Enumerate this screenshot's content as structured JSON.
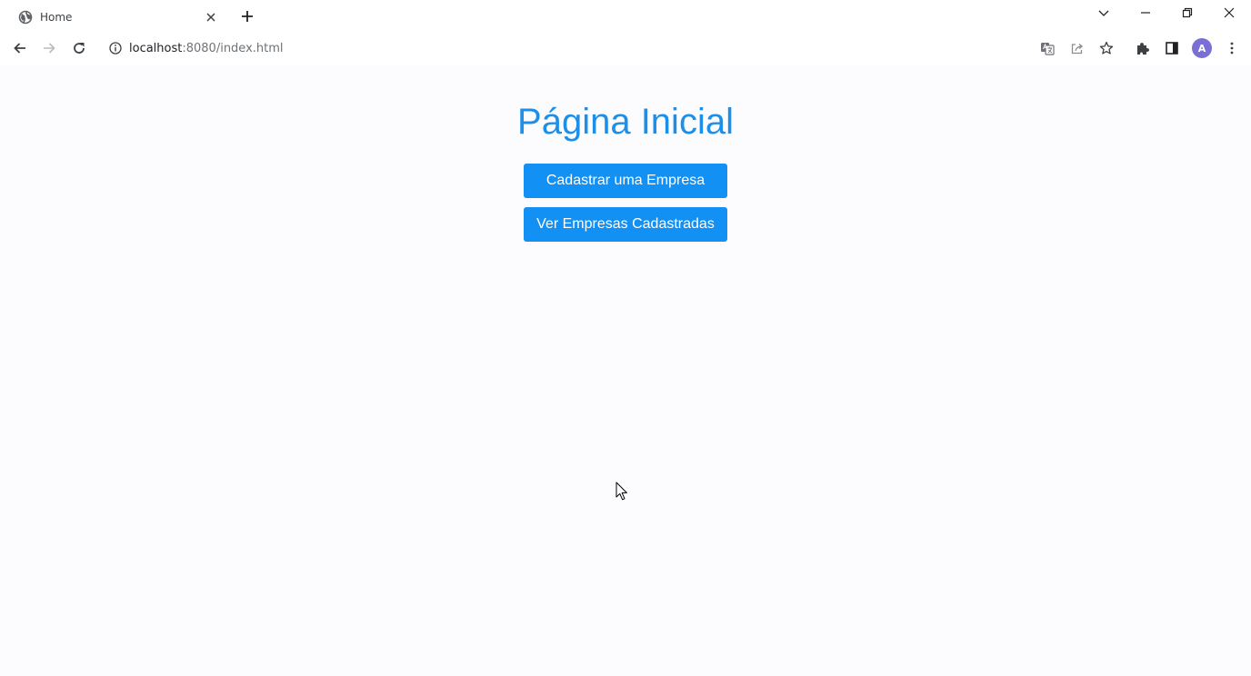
{
  "browser": {
    "tab": {
      "title": "Home"
    },
    "address_bar": {
      "host": "localhost",
      "path": ":8080/index.html"
    },
    "profile": {
      "initial": "A"
    }
  },
  "page": {
    "heading": "Página Inicial",
    "buttons": {
      "register": "Cadastrar uma Empresa",
      "list": "Ver Empresas Cadastradas"
    }
  },
  "colors": {
    "accent": "#1390f3",
    "heading": "#1e8fe8",
    "background": "#fcfcff"
  },
  "icons": [
    "globe-icon",
    "close-icon",
    "plus-icon",
    "chevron-down-icon",
    "minimize-icon",
    "restore-icon",
    "back-icon",
    "forward-icon",
    "reload-icon",
    "info-icon",
    "translate-icon",
    "share-icon",
    "star-icon",
    "puzzle-icon",
    "side-panel-icon",
    "kebab-menu-icon",
    "mouse-cursor-icon"
  ]
}
